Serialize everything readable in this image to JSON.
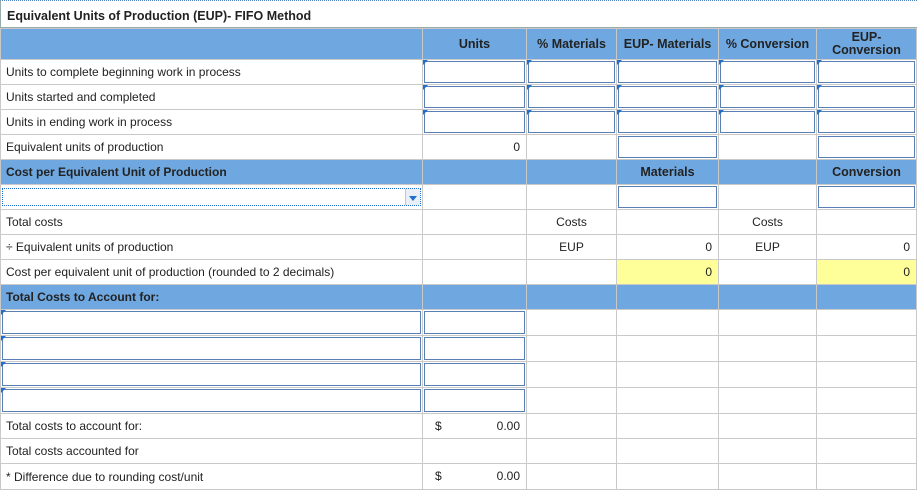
{
  "title": "Equivalent Units of Production (EUP)- FIFO Method",
  "headers": {
    "units": "Units",
    "pct_materials": "% Materials",
    "eup_materials": "EUP- Materials",
    "pct_conversion": "% Conversion",
    "eup_conversion": "EUP-\nConversion"
  },
  "rows": {
    "beginning": "Units to complete beginning work in process",
    "started": "Units started and completed",
    "ending": "Units in ending work in process",
    "equivalent": "Equivalent units of production",
    "equivalent_units_value": "0"
  },
  "cost_section": {
    "title": "Cost per Equivalent Unit of Production",
    "materials": "Materials",
    "conversion": "Conversion",
    "total_costs": "Total costs",
    "costs_label": "Costs",
    "eup_label": "EUP",
    "divide_label": "÷ Equivalent units of production",
    "cost_per_unit_label": "Cost per equivalent unit of production (rounded to 2 decimals)",
    "materials_eup": "0",
    "materials_cost_per_unit": "0",
    "conversion_eup": "0",
    "conversion_cost_per_unit": "0"
  },
  "account_section": {
    "title": "Total Costs to Account for:",
    "total_to_account": "Total costs to account for:",
    "total_accounted": "Total costs accounted for",
    "difference": "* Difference due to rounding cost/unit",
    "currency": "$",
    "total_to_account_value": "0.00",
    "difference_value": "0.00"
  }
}
